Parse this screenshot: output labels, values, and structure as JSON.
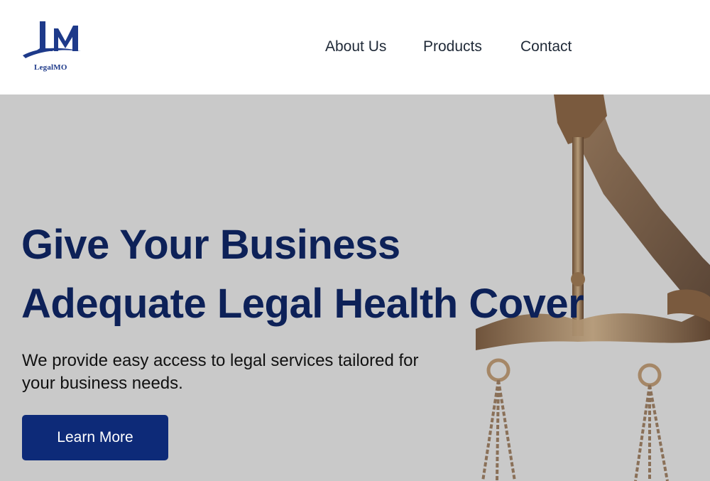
{
  "header": {
    "logo": {
      "brand": "LegalMO",
      "icon": "lm-monogram-logo"
    },
    "nav": [
      {
        "label": "About Us"
      },
      {
        "label": "Products"
      },
      {
        "label": "Contact"
      }
    ]
  },
  "hero": {
    "title_line1": "Give Your Business",
    "title_line2": "Adequate Legal Health Cover",
    "subtitle_line1": "We provide easy access to legal services tailored for",
    "subtitle_line2": "your business needs.",
    "cta_label": "Learn More",
    "background_image": "scales-of-justice-photo"
  },
  "colors": {
    "brand_navy": "#0d2158",
    "button_blue": "#0d2a78",
    "logo_blue": "#1e3a8a",
    "hero_bg": "#c9c9c9",
    "text_dark": "#1f2937"
  }
}
